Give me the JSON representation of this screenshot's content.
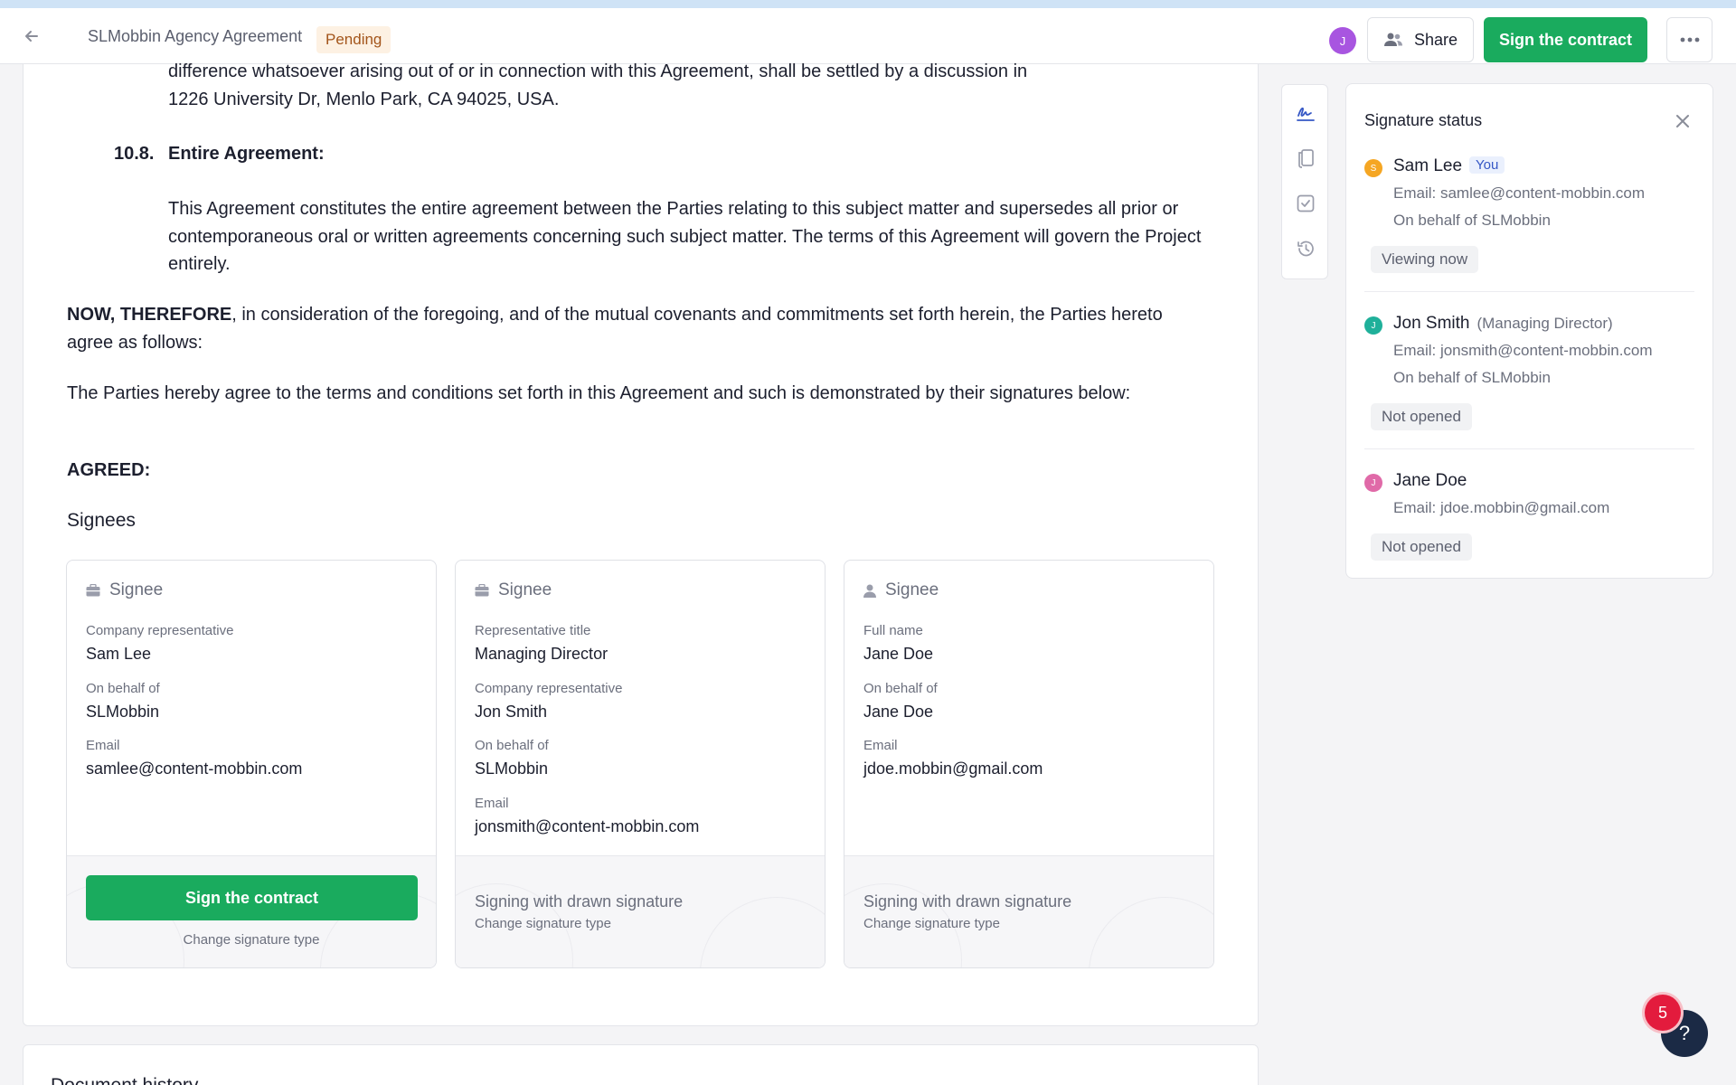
{
  "header": {
    "title": "SLMobbin Agency Agreement",
    "status": "Pending",
    "user_initial": "J",
    "share_label": "Share",
    "sign_label": "Sign the contract"
  },
  "document": {
    "para_top_1": "difference whatsoever arising out of or in connection with this Agreement, shall be settled by a discussion in",
    "para_top_2": "1226 University Dr, Menlo Park, CA 94025, USA.",
    "section_num": "10.8.",
    "section_title": "Entire Agreement:",
    "entire_1": "This Agreement constitutes the entire agreement between the Parties relating to this subject matter and supersedes all prior or",
    "entire_2": "contemporaneous oral or written agreements concerning such subject matter. The terms of this Agreement will govern the Project",
    "entire_3": "entirely.",
    "now_bold": "NOW, THEREFORE",
    "now_rest": ", in consideration of the foregoing, and of the mutual covenants and commitments set forth herein, the Parties hereto",
    "now_2": "agree as follows:",
    "hereby": "The Parties hereby agree to the terms and conditions set forth in this Agreement and such is demonstrated by their signatures below:",
    "agreed": "AGREED:",
    "signees_heading": "Signees",
    "next_section_partial": "Document history"
  },
  "signees": [
    {
      "head": "Signee",
      "fields": [
        {
          "label": "Company representative",
          "value": "Sam Lee"
        },
        {
          "label": "On behalf of",
          "value": "SLMobbin"
        },
        {
          "label": "Email",
          "value": "samlee@content-mobbin.com"
        }
      ],
      "sign_label": "Sign the contract",
      "change_label": "Change signature type"
    },
    {
      "head": "Signee",
      "fields": [
        {
          "label": "Representative title",
          "value": "Managing Director"
        },
        {
          "label": "Company representative",
          "value": "Jon Smith"
        },
        {
          "label": "On behalf of",
          "value": "SLMobbin"
        },
        {
          "label": "Email",
          "value": "jonsmith@content-mobbin.com"
        }
      ],
      "method": "Signing with drawn signature",
      "change_label": "Change signature type"
    },
    {
      "head": "Signee",
      "fields": [
        {
          "label": "Full name",
          "value": "Jane Doe"
        },
        {
          "label": "On behalf of",
          "value": "Jane Doe"
        },
        {
          "label": "Email",
          "value": "jdoe.mobbin@gmail.com"
        }
      ],
      "method": "Signing with drawn signature",
      "change_label": "Change signature type"
    }
  ],
  "signature_status": {
    "title": "Signature status",
    "people": [
      {
        "initial": "S",
        "name": "Sam Lee",
        "badge": "You",
        "email": "Email: samlee@content-mobbin.com",
        "behalf": "On behalf of SLMobbin",
        "status": "Viewing now",
        "color": "#f5a623"
      },
      {
        "initial": "J",
        "name": "Jon Smith",
        "role": "(Managing Director)",
        "email": "Email: jonsmith@content-mobbin.com",
        "behalf": "On behalf of SLMobbin",
        "status": "Not opened",
        "color": "#1fb09a"
      },
      {
        "initial": "J",
        "name": "Jane Doe",
        "email": "Email: jdoe.mobbin@gmail.com",
        "status": "Not opened",
        "color": "#e06aa8"
      }
    ]
  },
  "help": {
    "badge_count": "5",
    "icon": "?"
  },
  "icons": {
    "back": "arrow-left-icon",
    "share": "users-icon",
    "more": "dots-horizontal-icon",
    "close": "close-icon",
    "rail": [
      "signature-icon",
      "pages-icon",
      "checkbox-icon",
      "history-icon"
    ],
    "signee_company": "briefcase-icon",
    "signee_person": "person-icon"
  },
  "colors": {
    "accent_green": "#1aab5e",
    "pending_bg": "#fdf1e3",
    "pending_text": "#a3551b",
    "you_badge": "#3557c5",
    "notif_red": "#e31b3d"
  }
}
